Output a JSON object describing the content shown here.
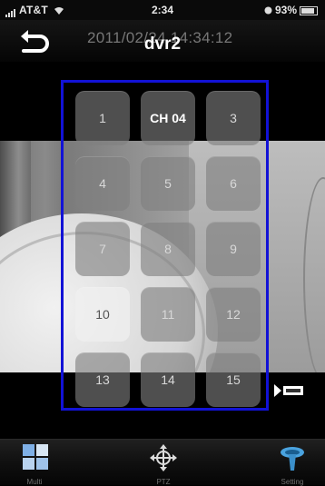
{
  "status_bar": {
    "carrier": "AT&T",
    "time": "2:34",
    "battery": "93%"
  },
  "nav": {
    "title": "dvr2",
    "timestamp": "2011/02/24 14:34:12",
    "back_icon": "back-arrow-icon"
  },
  "channels": [
    {
      "label": "1"
    },
    {
      "label": "CH 04"
    },
    {
      "label": "3"
    },
    {
      "label": "4"
    },
    {
      "label": "5"
    },
    {
      "label": "6"
    },
    {
      "label": "7"
    },
    {
      "label": "8"
    },
    {
      "label": "9"
    },
    {
      "label": "10"
    },
    {
      "label": "11"
    },
    {
      "label": "12"
    },
    {
      "label": "13"
    },
    {
      "label": "14"
    },
    {
      "label": "15"
    }
  ],
  "toolbar": {
    "items": [
      {
        "label": "Multi",
        "icon": "grid-layout-icon"
      },
      {
        "label": "PTZ",
        "icon": "move-arrows-icon"
      },
      {
        "label": "Setting",
        "icon": "settings-icon"
      }
    ]
  },
  "colors": {
    "frame": "#1212d6",
    "accent_toolbar_icon": "#4aa3df"
  }
}
